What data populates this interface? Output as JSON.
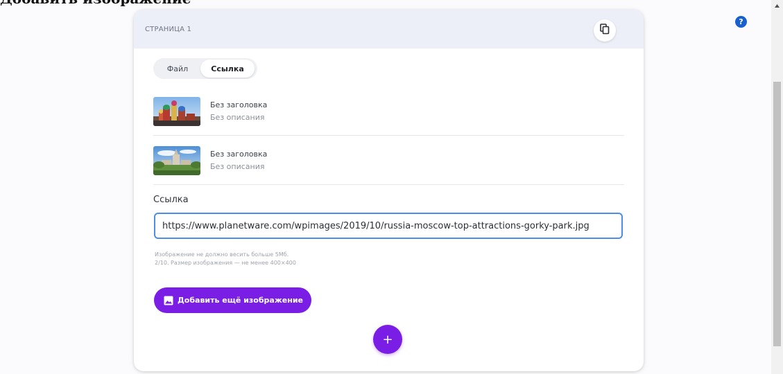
{
  "top_heading": "Добавить изображение",
  "card": {
    "page_label": "СТРАНИЦА 1",
    "copy_icon": "copy-icon"
  },
  "toggle": {
    "file_label": "Файл",
    "link_label": "Ссылка",
    "selected": "Ссылка"
  },
  "images": [
    {
      "title": "Без заголовка",
      "description": "Без описания",
      "thumb": "cathedral-photo"
    },
    {
      "title": "Без заголовка",
      "description": "Без описания",
      "thumb": "park-photo"
    }
  ],
  "link_field": {
    "label": "Ссылка",
    "value": "https://www.planetware.com/wpimages/2019/10/russia-moscow-top-attractions-gorky-park.jpg"
  },
  "hints": {
    "line1": "Изображение не должно весить больше 5Мб.",
    "line2": "2/10. Размер изображения — не менее 400×400"
  },
  "add_image_button": {
    "label": "Добавить ещё изображение",
    "icon": "image-icon"
  },
  "add_block_button": {
    "label": "+"
  },
  "help": {
    "label": "?"
  },
  "colors": {
    "accent": "#7b1ee5",
    "header_bg": "#eceff8",
    "input_border": "#4c8de8",
    "help_blue": "#1a5fd0"
  }
}
